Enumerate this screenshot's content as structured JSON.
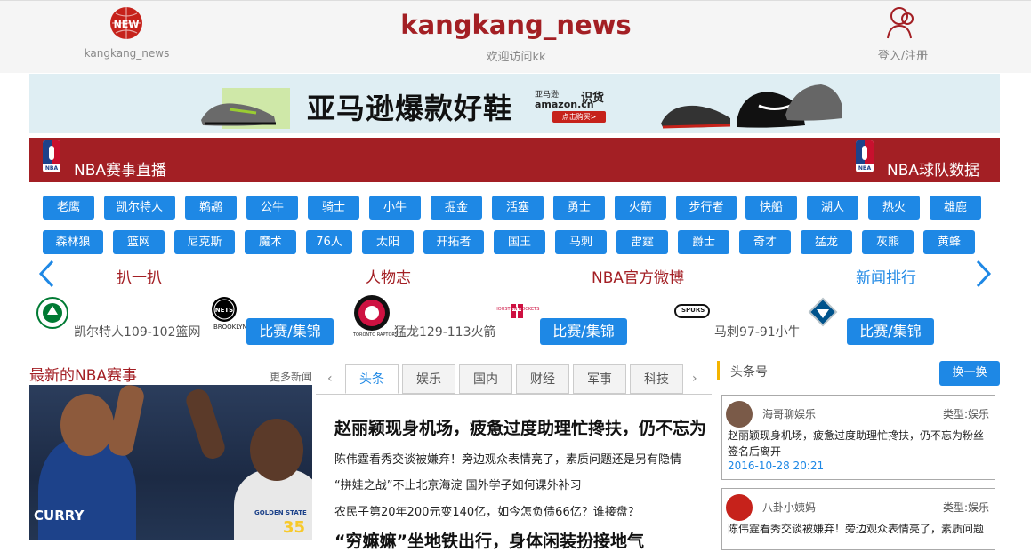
{
  "header": {
    "logo_badge": "NEW",
    "logo_label": "kangkang_news",
    "site_title": "kangkang_news",
    "welcome": "欢迎访问kk",
    "login": "登入/注册"
  },
  "banner": {
    "text": "亚马逊爆款好鞋",
    "amazon_cn": "亚马逊",
    "amazon_brand": "amazon.cn",
    "shihuo": "识货",
    "buy_label": "点击购买>"
  },
  "nba_bar": {
    "left_title": "NBA赛事直播",
    "right_title": "NBA球队数据",
    "logo_caption": "NBA"
  },
  "teams_row1": [
    "老鹰",
    "凯尔特人",
    "鹈鹕",
    "公牛",
    "骑士",
    "小牛",
    "掘金",
    "活塞",
    "勇士",
    "火箭",
    "步行者",
    "快船",
    "湖人",
    "热火",
    "雄鹿"
  ],
  "teams_row2": [
    "森林狼",
    "篮网",
    "尼克斯",
    "魔术",
    "76人",
    "太阳",
    "开拓者",
    "国王",
    "马刺",
    "雷霆",
    "爵士",
    "奇才",
    "猛龙",
    "灰熊",
    "黄蜂"
  ],
  "section_nav": {
    "prev_icon": "chevron-left-icon",
    "next_icon": "chevron-right-icon",
    "items": [
      "扒一扒",
      "人物志",
      "NBA官方微博",
      "新闻排行"
    ]
  },
  "games": [
    {
      "score": "凯尔特人109-102篮网",
      "button": "比赛/集锦",
      "logo_a_caption": "",
      "logo_b_caption": "BROOKLYN"
    },
    {
      "score": "猛龙129-113火箭",
      "button": "比赛/集锦",
      "logo_a_caption": "TORONTO RAPTORS",
      "logo_b_caption": "HOUSTON ROCKETS"
    },
    {
      "score": "马刺97-91小牛",
      "button": "比赛/集锦",
      "logo_a_caption": "SPURS",
      "logo_b_caption": ""
    }
  ],
  "latest": {
    "title": "最新的NBA赛事",
    "more": "更多新闻",
    "hero_jersey_left": "CURRY",
    "hero_jersey_right_num": "35",
    "hero_jersey_right_txt": "GOLDEN STATE"
  },
  "news_tabs": {
    "prev": "‹",
    "next": "›",
    "tabs": [
      "头条",
      "娱乐",
      "国内",
      "财经",
      "军事",
      "科技"
    ],
    "active": "头条"
  },
  "news": {
    "headline": "赵丽颖现身机场，疲惫过度助理忙搀扶，仍不忘为",
    "lines": [
      "陈伟霆看秀交谈被嫌弃！旁边观众表情亮了，素质问题还是另有隐情",
      "“拼娃之战”不止北京海淀 国外学子如何课外补习",
      "农民子第20年200元变140亿，如今怎负债66亿？谁接盘？"
    ],
    "headline2": "“穷嫲嫲”坐地铁出行，身体闲装扮接地气"
  },
  "toutiao": {
    "title": "头条号",
    "swap_button": "换一换",
    "cards": [
      {
        "author": "海哥聊娱乐",
        "type": "类型:娱乐",
        "text": "赵丽颖现身机场，疲惫过度助理忙搀扶，仍不忘为粉丝签名后离开",
        "date": "2016-10-28 20:21"
      },
      {
        "author": "八卦小姨妈",
        "type": "类型:娱乐",
        "text": "陈伟霆看秀交谈被嫌弃！旁边观众表情亮了，素质问题",
        "date": ""
      }
    ]
  },
  "colors": {
    "brand_red": "#a31f24",
    "accent_blue": "#1e88e5"
  }
}
